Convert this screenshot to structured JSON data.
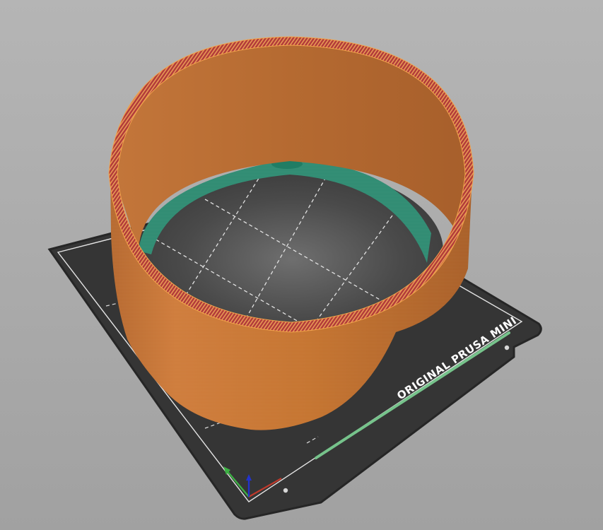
{
  "viewport": {
    "background_top": "#b4b4b4",
    "background_bottom": "#a2a2a2"
  },
  "bed": {
    "label": "ORIGINAL PRUSA MINI",
    "plate_color": "#333333",
    "edge_color": "#262626",
    "border_line_color": "#e6e6e6",
    "grid_line_color": "#d6d6d6",
    "accent_stripe_color": "#7ec891"
  },
  "model": {
    "type": "cylinder-wall",
    "outer_color": "#c97838",
    "inner_color": "#b86c32",
    "rim_color": "#b43a3a",
    "rim_highlight_color": "#f3a34a",
    "first_layer_color": "#2d8a70"
  },
  "axes": {
    "x_color": "#c0392b",
    "y_color": "#3cb043",
    "z_color": "#2233cc",
    "x_icon": "x-axis-arrow-icon",
    "y_icon": "y-axis-arrow-icon",
    "z_icon": "z-axis-arrow-icon"
  }
}
